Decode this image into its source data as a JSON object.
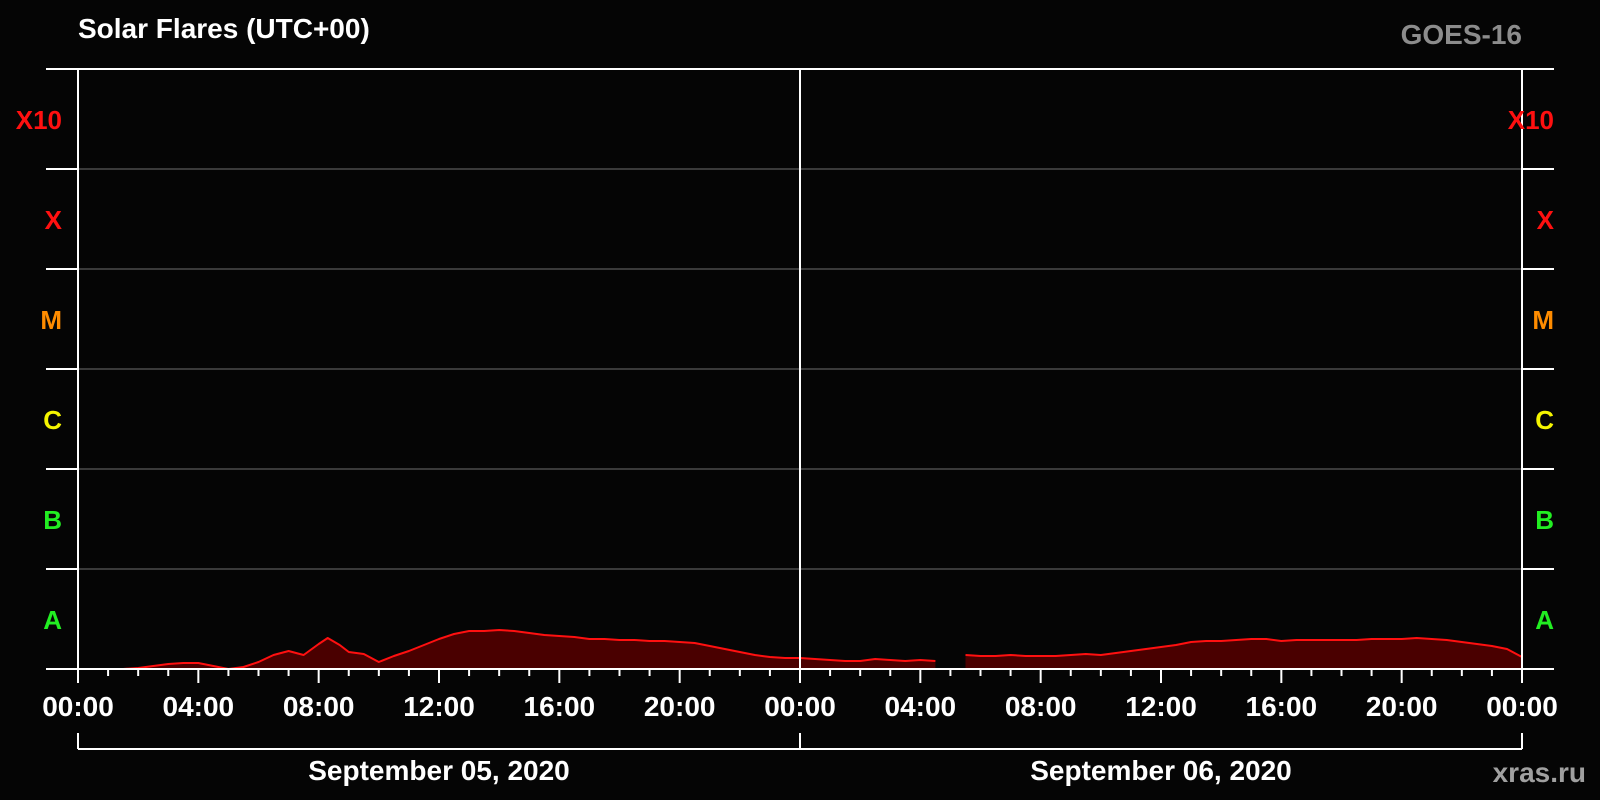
{
  "chart_data": {
    "type": "area",
    "title": "Solar Flares (UTC+00)",
    "satellite": "GOES-16",
    "watermark": "xras.ru",
    "background": "#050505",
    "colors": {
      "line": "#ff1010",
      "fill": "#4a0000",
      "axis": "#ffffff",
      "grid": "#4d4d4d",
      "title": "#ffffff",
      "satellite_label": "#8c8c8c",
      "watermark": "#a0a0a0"
    },
    "x_range_hours": [
      0,
      48
    ],
    "x_tick_labels": [
      "00:00",
      "04:00",
      "08:00",
      "12:00",
      "16:00",
      "20:00",
      "00:00",
      "04:00",
      "08:00",
      "12:00",
      "16:00",
      "20:00",
      "00:00"
    ],
    "dates": [
      "September 05, 2020",
      "September 06, 2020"
    ],
    "y_scale": "log",
    "y_range_log_flux": [
      -8,
      -2
    ],
    "y_classes": [
      {
        "label": "A",
        "color": "#22ee22"
      },
      {
        "label": "B",
        "color": "#22ee22"
      },
      {
        "label": "C",
        "color": "#f5f500"
      },
      {
        "label": "M",
        "color": "#ff8c00"
      },
      {
        "label": "X",
        "color": "#ff1010"
      },
      {
        "label": "X10",
        "color": "#ff1010"
      }
    ],
    "series": [
      {
        "x_hours": [
          0,
          0.3,
          0.6,
          1.0,
          1.5,
          2.0,
          2.5,
          3.0,
          3.5,
          4.0,
          4.5,
          5.0,
          5.5,
          6.0,
          6.5,
          7.0,
          7.5,
          8.0,
          8.3,
          8.7,
          9.0,
          9.5,
          10.0,
          10.5,
          11.0,
          11.5,
          12.0,
          12.5,
          13.0,
          13.5,
          14.0,
          14.5,
          15.0,
          15.5,
          16.0,
          16.5,
          17.0,
          17.5,
          18.0,
          18.5,
          19.0,
          19.5,
          20.0,
          20.5,
          21.0,
          21.5,
          22.0,
          22.5,
          23.0,
          23.5,
          24.0,
          24.5,
          25.0,
          25.5,
          26.0,
          26.5,
          27.0,
          27.5,
          28.0,
          28.5,
          null,
          29.5,
          30.0,
          30.5,
          31.0,
          31.5,
          32.0,
          32.5,
          33.0,
          33.5,
          34.0,
          34.5,
          35.0,
          35.5,
          36.0,
          36.5,
          37.0,
          37.5,
          38.0,
          38.5,
          39.0,
          39.5,
          40.0,
          40.5,
          41.0,
          41.5,
          42.0,
          42.5,
          43.0,
          43.5,
          44.0,
          44.5,
          45.0,
          45.5,
          46.0,
          46.5,
          47.0,
          47.5,
          48.0
        ],
        "log_flux": [
          -8.0,
          -8.0,
          -8.0,
          -8.0,
          -8.0,
          -7.99,
          -7.97,
          -7.95,
          -7.94,
          -7.94,
          -7.97,
          -8.0,
          -7.98,
          -7.93,
          -7.86,
          -7.82,
          -7.86,
          -7.75,
          -7.69,
          -7.76,
          -7.83,
          -7.85,
          -7.93,
          -7.87,
          -7.82,
          -7.76,
          -7.7,
          -7.65,
          -7.62,
          -7.62,
          -7.61,
          -7.62,
          -7.64,
          -7.66,
          -7.67,
          -7.68,
          -7.7,
          -7.7,
          -7.71,
          -7.71,
          -7.72,
          -7.72,
          -7.73,
          -7.74,
          -7.77,
          -7.8,
          -7.83,
          -7.86,
          -7.88,
          -7.89,
          -7.89,
          -7.9,
          -7.91,
          -7.92,
          -7.92,
          -7.9,
          -7.91,
          -7.92,
          -7.91,
          -7.92,
          null,
          -7.86,
          -7.87,
          -7.87,
          -7.86,
          -7.87,
          -7.87,
          -7.87,
          -7.86,
          -7.85,
          -7.86,
          -7.84,
          -7.82,
          -7.8,
          -7.78,
          -7.76,
          -7.73,
          -7.72,
          -7.72,
          -7.71,
          -7.7,
          -7.7,
          -7.72,
          -7.71,
          -7.71,
          -7.71,
          -7.71,
          -7.71,
          -7.7,
          -7.7,
          -7.7,
          -7.69,
          -7.7,
          -7.71,
          -7.73,
          -7.75,
          -7.77,
          -7.8,
          -7.88
        ]
      }
    ],
    "grid": true
  }
}
